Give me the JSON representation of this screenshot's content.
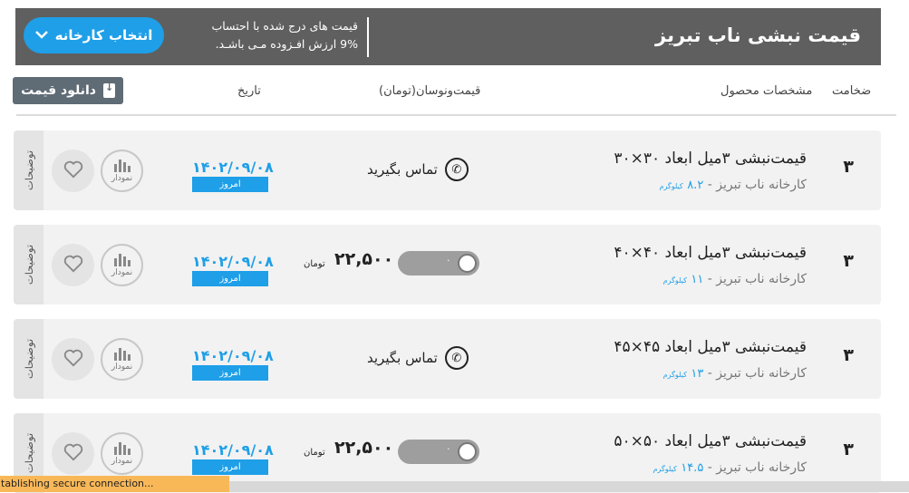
{
  "header": {
    "title": "قیمت نبشی ناب تبریز",
    "note_line1": "قیمت های درج شده با احتساب",
    "note_line2": "9% ارزش افـزوده مـی باشـد.",
    "factory_button": "انتخاب کارخانه",
    "chevron_icon": "chevron-down-icon"
  },
  "columns": {
    "thickness": "ضخامت",
    "specs": "مشخصات محصول",
    "price_fluctuation": "قیمت‌ونوسان(تومان)",
    "date": "تاریخ",
    "download_button": "دانلود قیمت"
  },
  "rows": [
    {
      "thickness": "۳",
      "name": "قیمت‌نبشی ۳میل ابعاد ۳۰×۳۰",
      "factory": "کارخانه ناب تبریز -",
      "weight": "۸.۲",
      "weight_unit": "کیلوگرم",
      "price": "",
      "currency": "",
      "contact": "تماس بگیرید",
      "date": "۱۴۰۲/۰۹/۰۸",
      "today": "امروز",
      "chart_label": "نمودار",
      "desc": "توضیحات"
    },
    {
      "thickness": "۳",
      "name": "قیمت‌نبشی ۳میل ابعاد ۴۰×۴۰",
      "factory": "کارخانه ناب تبریز -",
      "weight": "۱۱",
      "weight_unit": "کیلوگرم",
      "price": "۲۲,۵۰۰",
      "currency": "تومان",
      "toggle_value": "۰",
      "contact": "",
      "date": "۱۴۰۲/۰۹/۰۸",
      "today": "امروز",
      "chart_label": "نمودار",
      "desc": "توضیحات"
    },
    {
      "thickness": "۳",
      "name": "قیمت‌نبشی ۳میل ابعاد ۴۵×۴۵",
      "factory": "کارخانه ناب تبریز -",
      "weight": "۱۳",
      "weight_unit": "کیلوگرم",
      "price": "",
      "currency": "",
      "contact": "تماس بگیرید",
      "date": "۱۴۰۲/۰۹/۰۸",
      "today": "امروز",
      "chart_label": "نمودار",
      "desc": "توضیحات"
    },
    {
      "thickness": "۳",
      "name": "قیمت‌نبشی ۳میل ابعاد ۵۰×۵۰",
      "factory": "کارخانه ناب تبریز -",
      "weight": "۱۴.۵",
      "weight_unit": "کیلوگرم",
      "price": "۲۲,۵۰۰",
      "currency": "تومان",
      "toggle_value": "۰",
      "contact": "",
      "date": "۱۴۰۲/۰۹/۰۸",
      "today": "امروز",
      "chart_label": "نمودار",
      "desc": "توضیحات"
    }
  ],
  "status_bar": "tablishing secure connection...",
  "colors": {
    "accent": "#1e9fe8",
    "topbar": "#5f5f5f",
    "row_bg": "#f2f2f2",
    "status": "#f9b858"
  }
}
